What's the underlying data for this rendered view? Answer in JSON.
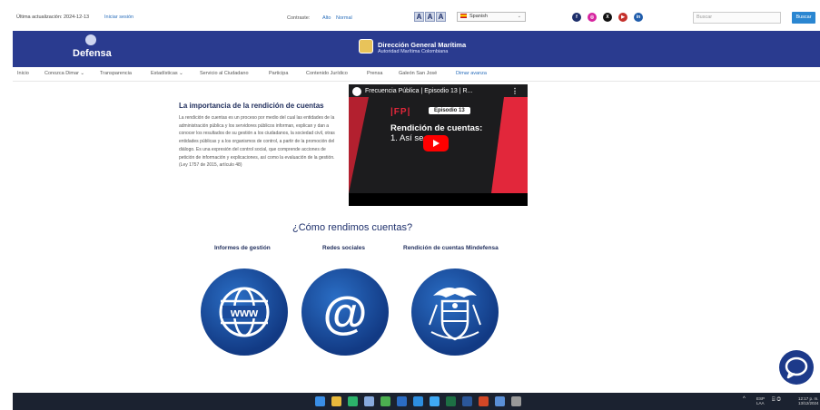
{
  "topbar": {
    "updated": "Última actualización: 2024-12-13",
    "login": "Iniciar sesión",
    "contrast_label": "Contraste:",
    "contrast_high": "Alto",
    "contrast_normal": "Normal",
    "font_buttons": [
      "A",
      "A",
      "A"
    ],
    "language": "Spanish",
    "social_icons": [
      "facebook-icon",
      "instagram-icon",
      "x-icon",
      "youtube-icon",
      "linkedin-icon"
    ],
    "search_placeholder": "Buscar",
    "search_button": "Buscar"
  },
  "banner": {
    "defensa": "Defensa",
    "dimar_title": "Dirección General Marítima",
    "dimar_subtitle": "Autoridad Marítima Colombiana"
  },
  "nav": {
    "items": [
      {
        "label": "Inicio"
      },
      {
        "label": "Conozca Dimar  ⌄"
      },
      {
        "label": "Transparencia"
      },
      {
        "label": "Estadísticas  ⌄"
      },
      {
        "label": "Servicio al Ciudadano"
      },
      {
        "label": "Participa"
      },
      {
        "label": "Contenido Jurídico"
      },
      {
        "label": "Prensa"
      },
      {
        "label": "Galeón San José"
      },
      {
        "label": "Dimar avanza"
      }
    ]
  },
  "section": {
    "title": "La importancia de la rendición de cuentas",
    "body": "La rendición de cuentas es un proceso por medio del cual las entidades de la administración pública y los servidores públicos informan, explican y dan a conocer los resultados de su gestión a los ciudadanos, la sociedad civil, otras entidades públicas y a los organismos de control, a partir de la promoción del diálogo. Es una expresión del control social, que comprende acciones de petición de información y explicaciones, así como la evaluación de la gestión. (Ley 1757 de 2015, artículo 48)"
  },
  "video": {
    "title": "Frecuencia Pública | Episodio 13 | R...",
    "brand": "|FP|",
    "episode": "Episodio 13",
    "line1": "Rendición de cuentas:",
    "line2": "1. Así se"
  },
  "rendimos": {
    "heading": "¿Cómo rendimos cuentas?",
    "items": [
      {
        "label": "Informes de gestión",
        "icon": "www-globe-icon"
      },
      {
        "label": "Redes sociales",
        "icon": "at-sign-icon"
      },
      {
        "label": "Rendición de cuentas Mindefensa",
        "icon": "colombia-coat-of-arms-icon"
      }
    ]
  },
  "taskbar": {
    "lang": [
      "ESP",
      "LAA"
    ],
    "time": "12:17 p. m.",
    "date": "13/12/2024"
  },
  "colors": {
    "banner": "#2a3b8f",
    "circle": "#1d4f9e",
    "accent": "#2a86d1"
  }
}
